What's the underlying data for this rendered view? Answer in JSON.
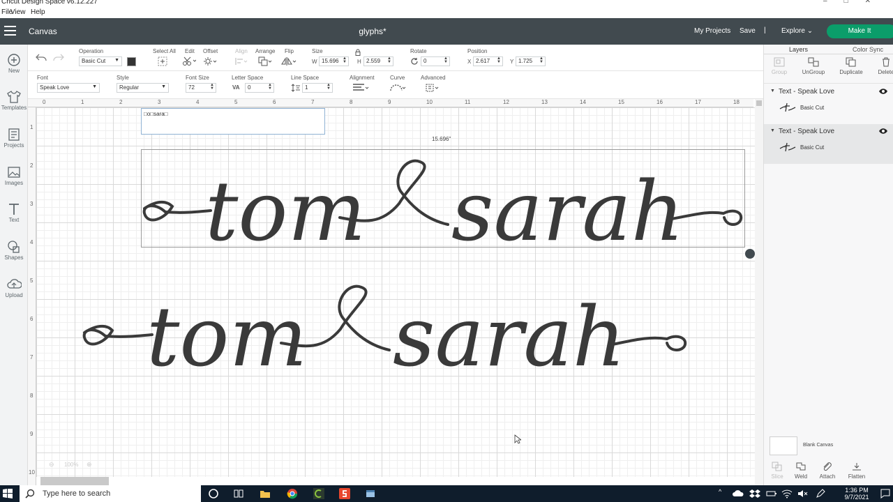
{
  "window": {
    "title": "Cricut Design Space  v6.12.227",
    "controls": [
      "–",
      "□",
      "✕"
    ]
  },
  "menu": [
    "File",
    "View",
    "Help"
  ],
  "header": {
    "section": "Canvas",
    "document": "glyphs*",
    "my_projects": "My Projects",
    "save": "Save",
    "separator": "|",
    "explore": "Explore",
    "make_it": "Make It",
    "make_it_color": "#0b9d6a"
  },
  "leftbar": [
    {
      "label": "New",
      "icon": "plus-circle-icon"
    },
    {
      "label": "Templates",
      "icon": "tshirt-icon"
    },
    {
      "label": "Projects",
      "icon": "projects-icon"
    },
    {
      "label": "Images",
      "icon": "images-icon"
    },
    {
      "label": "Text",
      "icon": "text-icon"
    },
    {
      "label": "Shapes",
      "icon": "shapes-icon"
    },
    {
      "label": "Upload",
      "icon": "upload-cloud-icon"
    }
  ],
  "toolbar1": {
    "operation_label": "Operation",
    "operation_value": "Basic Cut",
    "select_all": "Select All",
    "edit": "Edit",
    "offset": "Offset",
    "align": "Align",
    "arrange": "Arrange",
    "flip": "Flip",
    "size_label": "Size",
    "w_label": "W",
    "w_value": "15.696",
    "h_label": "H",
    "h_value": "2.559",
    "rotate_label": "Rotate",
    "rotate_value": "0",
    "position_label": "Position",
    "x_label": "X",
    "x_value": "2.617",
    "y_label": "Y",
    "y_value": "1.725"
  },
  "toolbar2": {
    "font_label": "Font",
    "font_value": "Speak Love",
    "style_label": "Style",
    "style_value": "Regular",
    "font_size_label": "Font Size",
    "font_size_value": "72",
    "letter_space_label": "Letter Space",
    "letter_space_value": "0",
    "line_space_label": "Line Space",
    "line_space_value": "1",
    "alignment_label": "Alignment",
    "curve_label": "Curve",
    "advanced_label": "Advanced"
  },
  "canvas": {
    "ruler_top": [
      "0",
      "1",
      "2",
      "3",
      "4",
      "5",
      "6",
      "7",
      "8",
      "9",
      "10",
      "11",
      "12",
      "13",
      "14",
      "15",
      "16",
      "17",
      "18"
    ],
    "ruler_left": [
      "1",
      "2",
      "3",
      "4",
      "5",
      "6",
      "7",
      "8",
      "9",
      "10"
    ],
    "text_box_value": "□o□sara□",
    "width_readout": "15.696\"",
    "zoom": "100%",
    "design_top": {
      "word1": "tom",
      "word2": "sarah"
    },
    "design_bottom": {
      "word1": "tom",
      "word2": "sarah"
    },
    "ink_color": "#3a3a3a"
  },
  "rightpanel": {
    "tabs": [
      "Layers",
      "Color Sync"
    ],
    "actions": [
      {
        "label": "Group",
        "disabled": true
      },
      {
        "label": "UnGroup",
        "disabled": false
      },
      {
        "label": "Duplicate",
        "disabled": false
      },
      {
        "label": "Delete",
        "disabled": false
      }
    ],
    "layers": [
      {
        "title": "Text - Speak Love",
        "child": "Basic Cut",
        "selected": false
      },
      {
        "title": "Text - Speak Love",
        "child": "Basic Cut",
        "selected": true
      }
    ],
    "blank_canvas": "Blank Canvas",
    "bottom_actions": [
      "Slice",
      "Weld",
      "Attach",
      "Flatten"
    ]
  },
  "taskbar": {
    "search_placeholder": "Type here to search",
    "time": "1:36 PM",
    "date": "9/7/2021"
  }
}
